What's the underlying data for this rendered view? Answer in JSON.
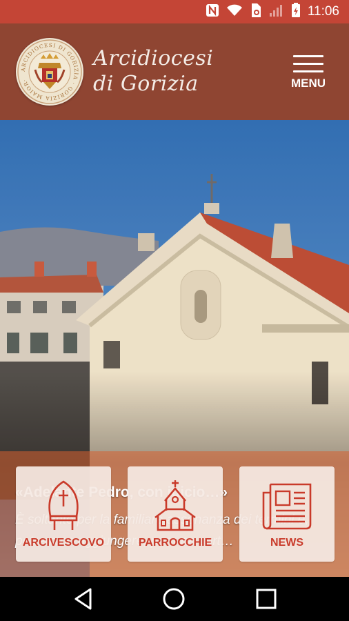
{
  "status_bar": {
    "time": "11:06",
    "icons": [
      "nfc-icon",
      "wifi-icon",
      "data-saver-icon",
      "signal-icon",
      "battery-icon"
    ]
  },
  "header": {
    "title_line1": "Arcidiocesi",
    "title_line2": "di Gorizia",
    "menu_label": "MENU",
    "logo_text": "ARCIDIOCESI DI GORIZIA · GORIZIA MAIOR·"
  },
  "hero": {
    "title": "«Adelante Pedro, con juicio…»",
    "excerpt": "È soltanto per la familiare assonanza dei termini e, potremmo aggiungere, per una cert…"
  },
  "tiles": [
    {
      "label": "ARCIVESCOVO",
      "icon": "mitre-icon"
    },
    {
      "label": "PARROCCHIE",
      "icon": "church-icon"
    },
    {
      "label": "NEWS",
      "icon": "newspaper-icon"
    }
  ],
  "navigation_bar": {
    "buttons": [
      "back-icon",
      "home-icon",
      "recents-icon"
    ]
  },
  "colors": {
    "status_bar": "#c44536",
    "header": "#8f4532",
    "accent": "#c93a2a",
    "tile_bg": "#f5e9e3"
  }
}
